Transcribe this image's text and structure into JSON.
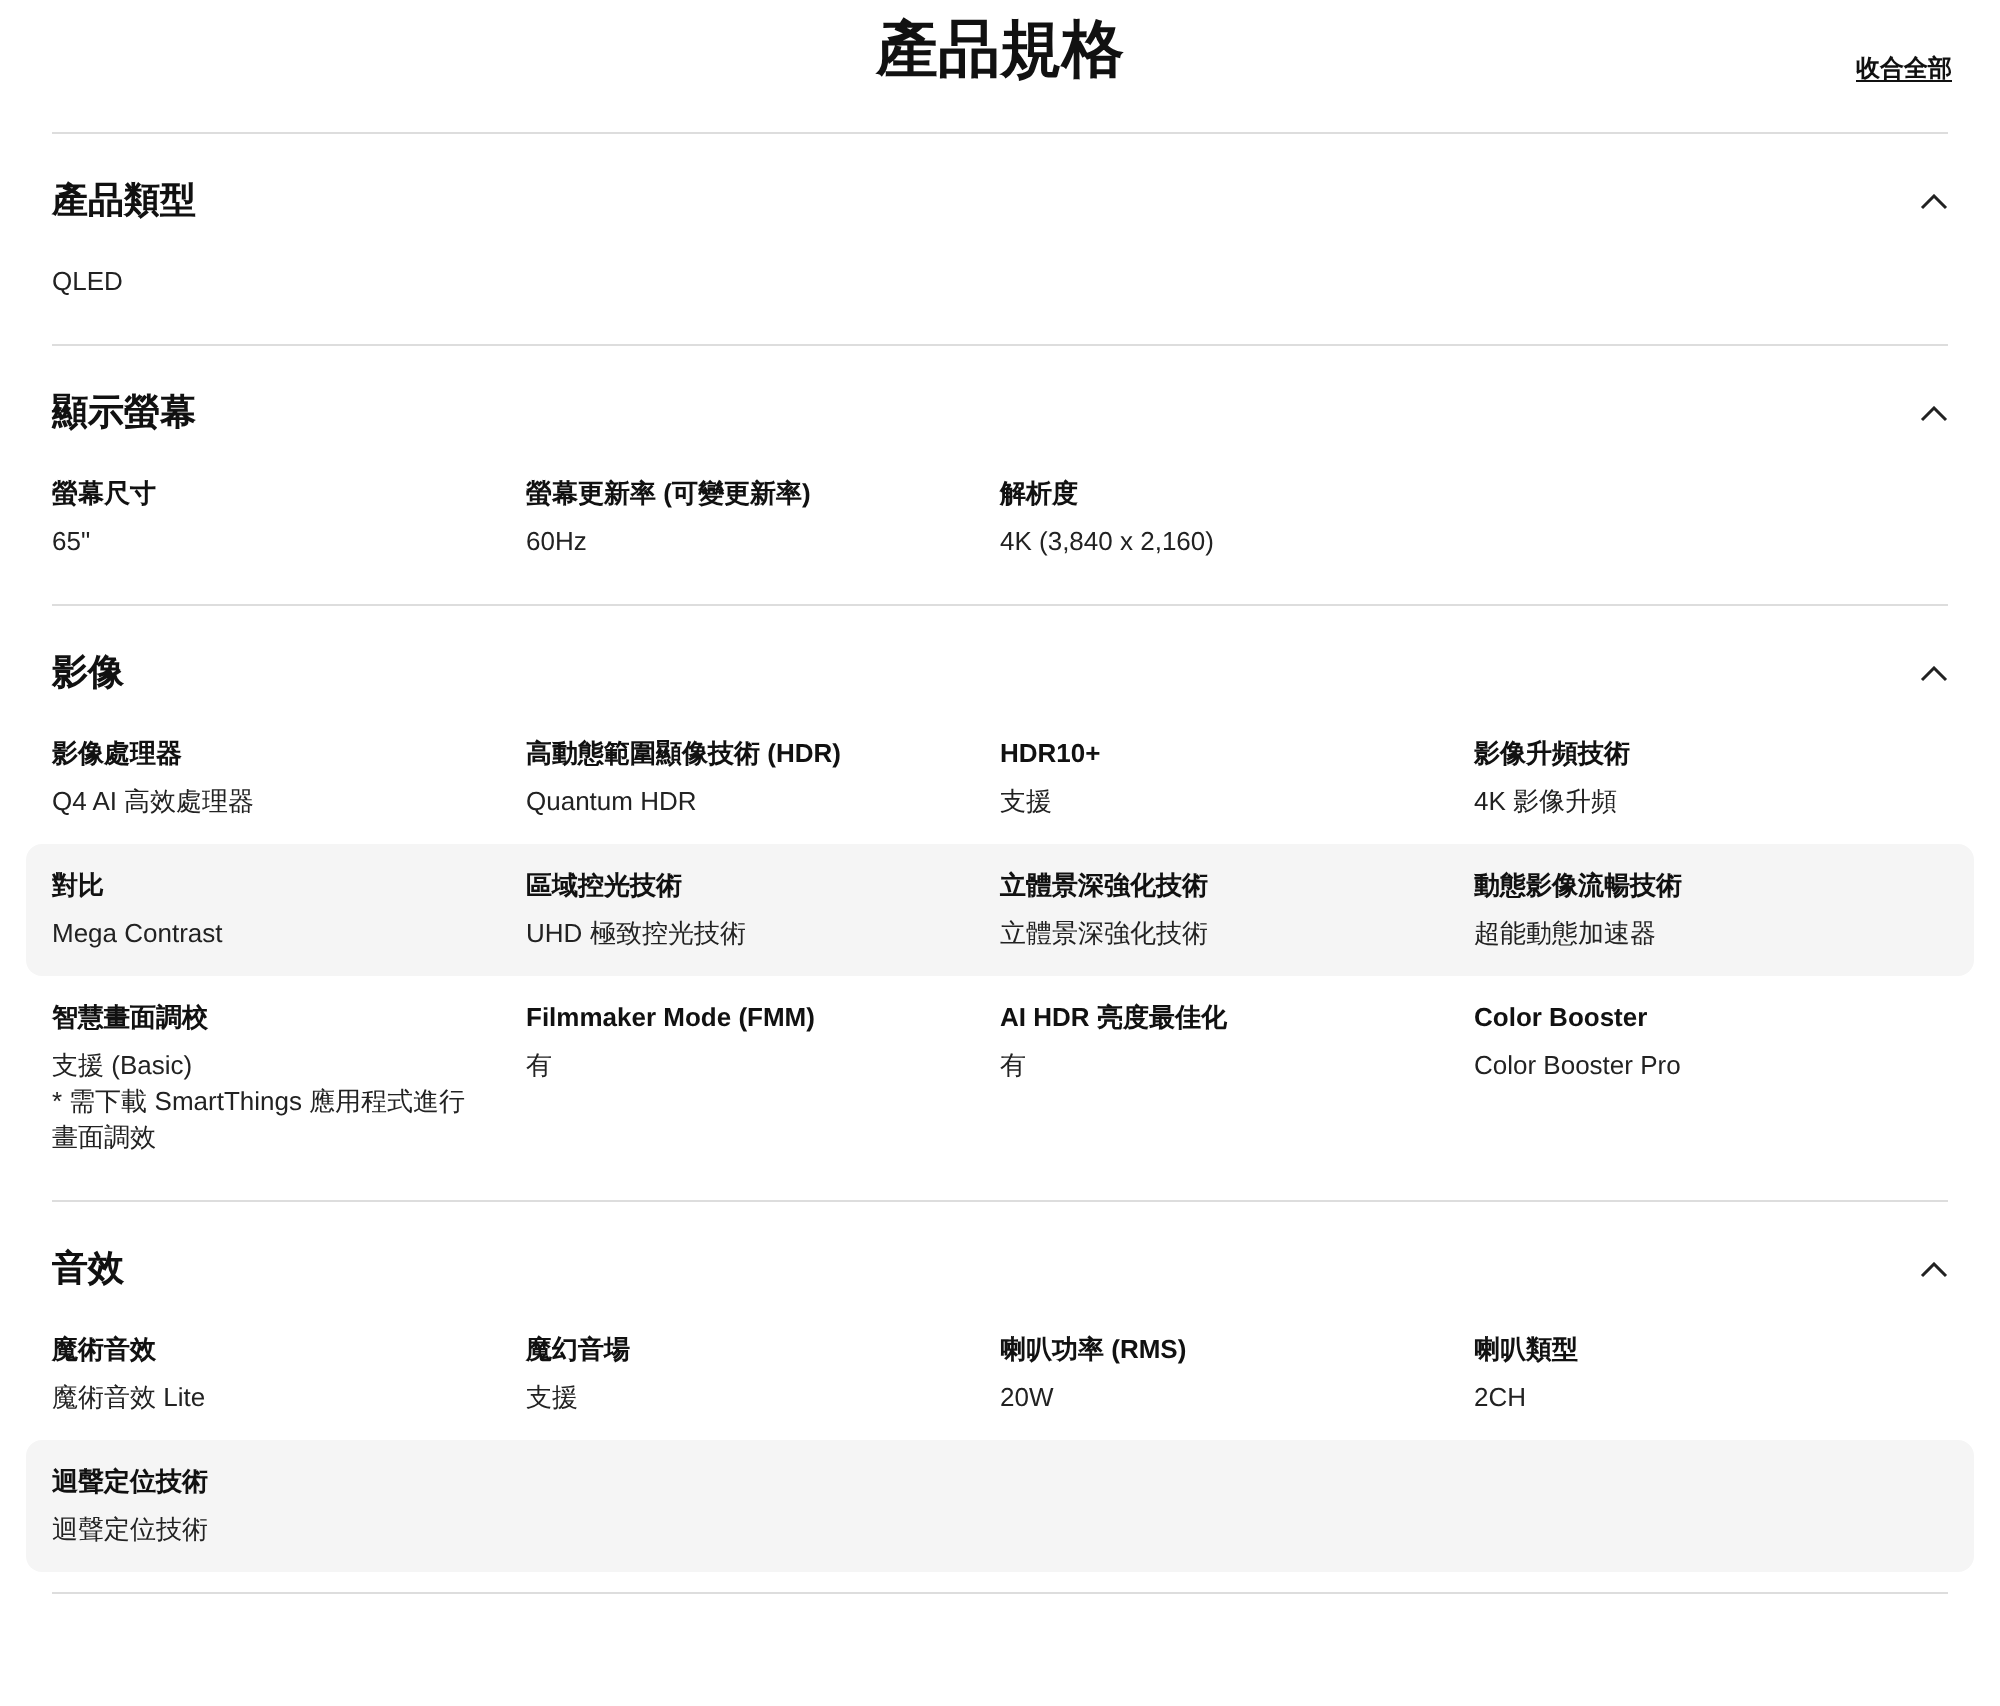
{
  "title": "產品規格",
  "collapse_all": "收合全部",
  "sections": [
    {
      "heading": "產品類型",
      "expanded": true,
      "rows": [
        {
          "shaded": false,
          "specs": [
            {
              "value": [
                "QLED"
              ]
            }
          ]
        }
      ]
    },
    {
      "heading": "顯示螢幕",
      "expanded": true,
      "rows": [
        {
          "shaded": false,
          "specs": [
            {
              "label": "螢幕尺寸",
              "value": [
                "65\""
              ]
            },
            {
              "label": "螢幕更新率 (可變更新率)",
              "value": [
                "60Hz"
              ]
            },
            {
              "label": "解析度",
              "value": [
                "4K (3,840 x 2,160)"
              ]
            }
          ]
        }
      ]
    },
    {
      "heading": "影像",
      "expanded": true,
      "rows": [
        {
          "shaded": false,
          "specs": [
            {
              "label": "影像處理器",
              "value": [
                "Q4 AI 高效處理器"
              ]
            },
            {
              "label": "高動態範圍顯像技術 (HDR)",
              "value": [
                "Quantum HDR"
              ]
            },
            {
              "label": "HDR10+",
              "value": [
                "支援"
              ]
            },
            {
              "label": "影像升頻技術",
              "value": [
                "4K 影像升頻"
              ]
            }
          ]
        },
        {
          "shaded": true,
          "specs": [
            {
              "label": "對比",
              "value": [
                "Mega Contrast"
              ]
            },
            {
              "label": "區域控光技術",
              "value": [
                "UHD 極致控光技術"
              ]
            },
            {
              "label": "立體景深強化技術",
              "value": [
                "立體景深強化技術"
              ]
            },
            {
              "label": "動態影像流暢技術",
              "value": [
                "超能動態加速器"
              ]
            }
          ]
        },
        {
          "shaded": false,
          "specs": [
            {
              "label": "智慧畫面調校",
              "value": [
                "支援 (Basic)",
                "* 需下載 SmartThings 應用程式進行",
                "畫面調效"
              ]
            },
            {
              "label": "Filmmaker Mode (FMM)",
              "value": [
                "有"
              ]
            },
            {
              "label": "AI HDR 亮度最佳化",
              "value": [
                "有"
              ]
            },
            {
              "label": "Color Booster",
              "value": [
                "Color Booster Pro"
              ]
            }
          ]
        }
      ]
    },
    {
      "heading": "音效",
      "expanded": true,
      "rows": [
        {
          "shaded": false,
          "specs": [
            {
              "label": "魔術音效",
              "value": [
                "魔術音效 Lite"
              ]
            },
            {
              "label": "魔幻音場",
              "value": [
                "支援"
              ]
            },
            {
              "label": "喇叭功率 (RMS)",
              "value": [
                "20W"
              ]
            },
            {
              "label": "喇叭類型",
              "value": [
                "2CH"
              ]
            }
          ]
        },
        {
          "shaded": true,
          "specs": [
            {
              "label": "迴聲定位技術",
              "value": [
                "迴聲定位技術"
              ]
            }
          ]
        }
      ]
    }
  ]
}
